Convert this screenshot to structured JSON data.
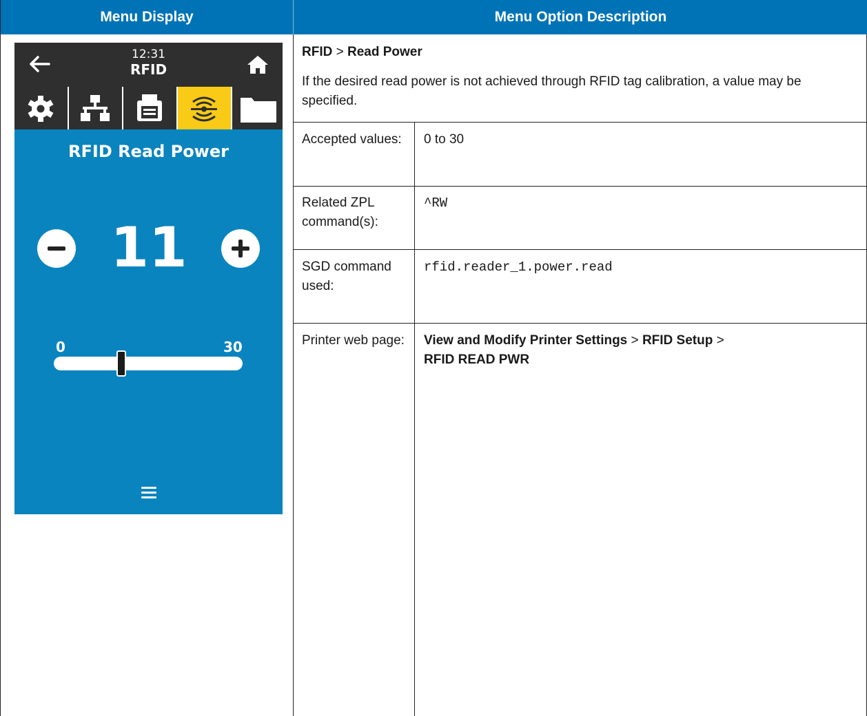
{
  "headers": {
    "left": "Menu Display",
    "right": "Menu Option Description"
  },
  "printer": {
    "time": "12:31",
    "title": "RFID",
    "tabs": [
      "settings-icon",
      "network-icon",
      "print-icon",
      "rfid-icon",
      "storage-icon"
    ],
    "active_tab_index": 3,
    "setting_title": "RFID Read Power",
    "value": "11",
    "range_min": "0",
    "range_max": "30",
    "slider_fraction": 0.35,
    "colors": {
      "screen_bg": "#0a84be",
      "bar_bg": "#2f2f2f",
      "active_tab": "#f9cb16",
      "header_bg": "#0073b6"
    }
  },
  "description": {
    "path_1": "RFID",
    "sep": ">",
    "path_2": "Read Power",
    "text": "If the desired read power is not achieved through RFID tag calibration, a value may be specified."
  },
  "rows": {
    "accepted_label": "Accepted values:",
    "accepted_value": "0 to 30",
    "zpl_label": "Related ZPL command(s):",
    "zpl_value": "^RW",
    "sgd_label": "SGD command used:",
    "sgd_value": "rfid.reader_1.power.read",
    "web_label": "Printer web page:",
    "web_part1": "View and Modify Printer Settings",
    "web_sep1": ">",
    "web_part2": "RFID Setup",
    "web_sep2": ">",
    "web_part3": "RFID READ PWR"
  }
}
